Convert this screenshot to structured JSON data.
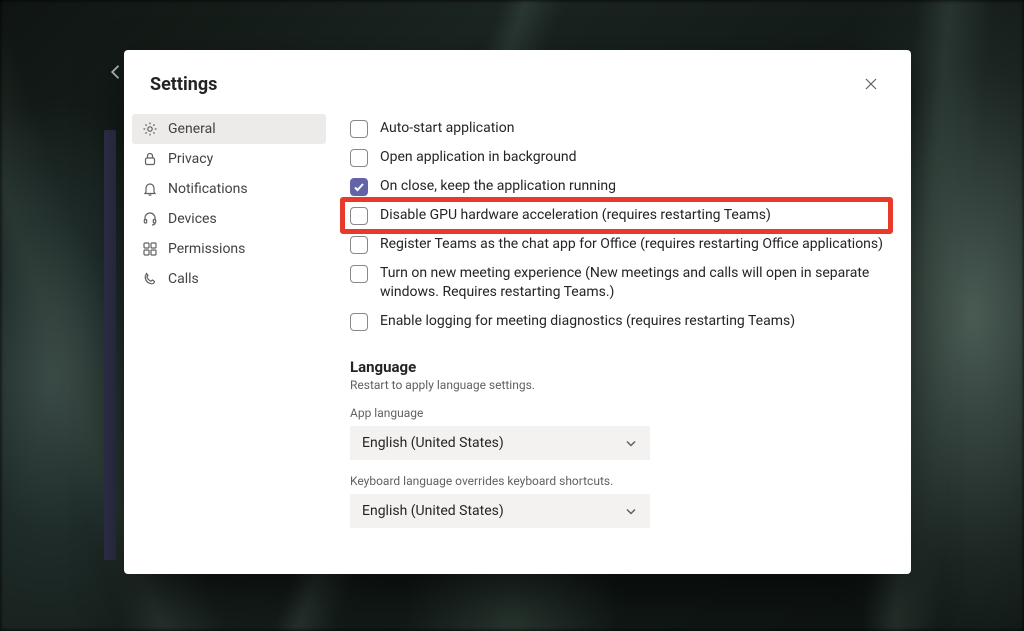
{
  "modal": {
    "title": "Settings"
  },
  "sidebar": {
    "items": [
      {
        "label": "General",
        "icon": "gear-icon",
        "active": true
      },
      {
        "label": "Privacy",
        "icon": "lock-icon",
        "active": false
      },
      {
        "label": "Notifications",
        "icon": "bell-icon",
        "active": false
      },
      {
        "label": "Devices",
        "icon": "headset-icon",
        "active": false
      },
      {
        "label": "Permissions",
        "icon": "permissions-icon",
        "active": false
      },
      {
        "label": "Calls",
        "icon": "phone-icon",
        "active": false
      }
    ]
  },
  "options": [
    {
      "label": "Auto-start application",
      "checked": false
    },
    {
      "label": "Open application in background",
      "checked": false
    },
    {
      "label": "On close, keep the application running",
      "checked": true
    },
    {
      "label": "Disable GPU hardware acceleration (requires restarting Teams)",
      "checked": false,
      "highlighted": true
    },
    {
      "label": "Register Teams as the chat app for Office (requires restarting Office applications)",
      "checked": false
    },
    {
      "label": "Turn on new meeting experience (New meetings and calls will open in separate windows. Requires restarting Teams.)",
      "checked": false
    },
    {
      "label": "Enable logging for meeting diagnostics (requires restarting Teams)",
      "checked": false
    }
  ],
  "language": {
    "heading": "Language",
    "subheading": "Restart to apply language settings.",
    "app_label": "App language",
    "app_value": "English (United States)",
    "kb_label": "Keyboard language overrides keyboard shortcuts.",
    "kb_value": "English (United States)"
  }
}
